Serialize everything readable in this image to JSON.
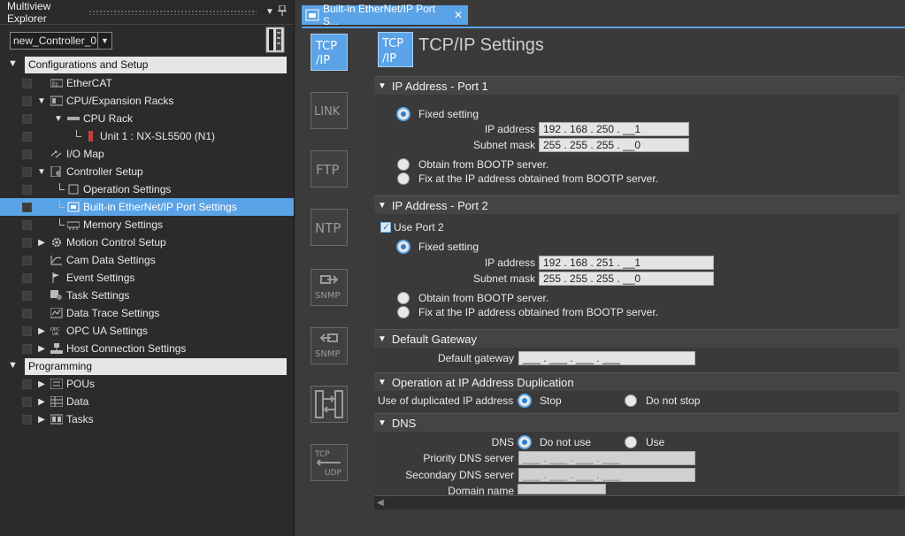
{
  "explorer": {
    "title": "Multiview Explorer",
    "pin_icon": "pin-icon",
    "dropdown_icon": "dropdown-icon",
    "controller": "new_Controller_0",
    "sections": {
      "config": "Configurations and Setup",
      "programming": "Programming"
    },
    "items": {
      "ethercat": "EtherCAT",
      "cpu_racks": "CPU/Expansion Racks",
      "cpu_rack": "CPU Rack",
      "unit1": "Unit 1 : NX-SL5500 (N1)",
      "io_map": "I/O Map",
      "controller_setup": "Controller Setup",
      "operation_settings": "Operation Settings",
      "ethernet_settings": "Built-in EtherNet/IP Port Settings",
      "memory_settings": "Memory Settings",
      "motion_control": "Motion Control Setup",
      "cam_data": "Cam Data Settings",
      "event_settings": "Event Settings",
      "task_settings": "Task Settings",
      "data_trace": "Data Trace Settings",
      "opc_ua": "OPC UA Settings",
      "host_connection": "Host Connection Settings",
      "pous": "POUs",
      "data": "Data",
      "tasks": "Tasks"
    }
  },
  "tab": {
    "label": "Built-in EtherNet/IP Port S...",
    "close": "✕"
  },
  "side_icons": [
    "tcpip-icon",
    "link-icon",
    "ftp-icon",
    "ntp-icon",
    "snmp-icon",
    "snmp-trap-icon",
    "fins-icon",
    "tcp-udp-icon"
  ],
  "header": {
    "title": "TCP/IP Settings",
    "icon_line1": "TCP",
    "icon_line2": "/IP"
  },
  "port1": {
    "title": "IP Address - Port 1",
    "fixed": "Fixed setting",
    "ip_label": "IP address",
    "ip_value": "192 . 168 . 250 . __1",
    "mask_label": "Subnet mask",
    "mask_value": "255 . 255 . 255 . __0",
    "bootp": "Obtain from BOOTP server.",
    "bootp_fix": "Fix at the IP address obtained from BOOTP server."
  },
  "port2": {
    "title": "IP Address - Port 2",
    "use_port": "Use Port 2",
    "fixed": "Fixed setting",
    "ip_label": "IP address",
    "ip_value": "192 . 168 . 251 . __1",
    "mask_label": "Subnet mask",
    "mask_value": "255 . 255 . 255 . __0",
    "bootp": "Obtain from BOOTP server.",
    "bootp_fix": "Fix at the IP address obtained from BOOTP server."
  },
  "gateway": {
    "title": "Default Gateway",
    "label": "Default gateway",
    "value": "___ . ___ . ___ . ___"
  },
  "duplication": {
    "title": "Operation at IP Address Duplication",
    "label": "Use of duplicated IP address",
    "stop": "Stop",
    "no_stop": "Do not stop"
  },
  "dns": {
    "title": "DNS",
    "label": "DNS",
    "not_use": "Do not use",
    "use": "Use",
    "priority_label": "Priority DNS server",
    "priority_value": "___ . ___ . ___ . ___",
    "secondary_label": "Secondary DNS server",
    "secondary_value": "___ . ___ . ___ . ___",
    "domain_label": "Domain name",
    "domain_value": ""
  },
  "colors": {
    "accent": "#5aa3e6",
    "panel_bg": "#3a3a3a",
    "tree_bg": "#2b2b2b"
  }
}
